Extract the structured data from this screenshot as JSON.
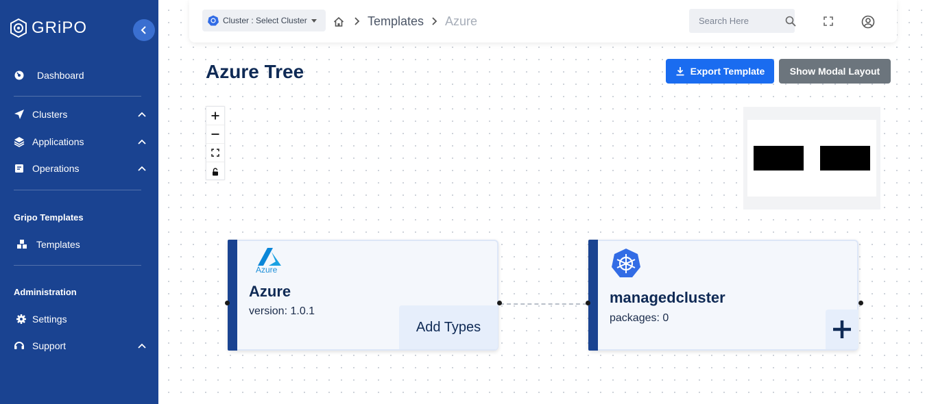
{
  "sidebar": {
    "logo_text": "GRiPO",
    "items": [
      {
        "label": "Dashboard"
      },
      {
        "label": "Clusters"
      },
      {
        "label": "Applications"
      },
      {
        "label": "Operations"
      },
      {
        "label": "Templates"
      },
      {
        "label": "Settings"
      },
      {
        "label": "Support"
      }
    ],
    "sections": {
      "templates": "Gripo Templates",
      "administration": "Administration"
    }
  },
  "topbar": {
    "cluster_select": "Cluster : Select Cluster",
    "breadcrumb": {
      "templates": "Templates",
      "current": "Azure"
    },
    "search_placeholder": "Search Here"
  },
  "page": {
    "title": "Azure Tree",
    "export_label": "Export Template",
    "modal_label": "Show Modal Layout"
  },
  "nodes": {
    "azure": {
      "logo_text": "Azure",
      "title": "Azure",
      "subtitle": "version: 1.0.1",
      "button": "Add Types"
    },
    "cluster": {
      "title": "managedcluster",
      "subtitle": "packages: 0"
    }
  },
  "colors": {
    "sidebar": "#1a4391",
    "primary": "#1a6cf0",
    "secondary": "#6c757d",
    "title": "#0f2a55"
  }
}
